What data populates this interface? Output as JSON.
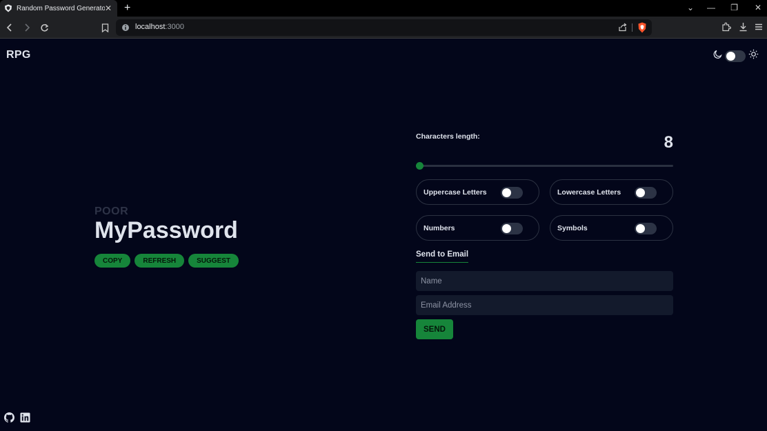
{
  "browser": {
    "tab_title": "Random Password Generator Tool",
    "tab_close": "✕",
    "new_tab": "+",
    "url_host": "localhost",
    "url_port": ":3000",
    "window_controls": [
      "⌄",
      "—",
      "❐",
      "✕"
    ]
  },
  "app": {
    "logo": "RPG",
    "theme_toggle": {
      "state": "dark"
    }
  },
  "password": {
    "strength": "POOR",
    "value": "MyPassword",
    "actions": [
      "COPY",
      "REFRESH",
      "SUGGEST"
    ]
  },
  "settings": {
    "length_label": "Characters length:",
    "length_value": "8",
    "length_slider": {
      "min": 8,
      "max": 64,
      "value": 8
    },
    "options": [
      {
        "label": "Uppercase Letters",
        "checked": false
      },
      {
        "label": "Lowercase Letters",
        "checked": false
      },
      {
        "label": "Numbers",
        "checked": false
      },
      {
        "label": "Symbols",
        "checked": false
      }
    ]
  },
  "email": {
    "title": "Send to Email",
    "name_placeholder": "Name",
    "email_placeholder": "Email Address",
    "send_label": "SEND"
  },
  "colors": {
    "background": "#03061a",
    "accent": "#16853a",
    "input_bg": "#131a2c"
  }
}
